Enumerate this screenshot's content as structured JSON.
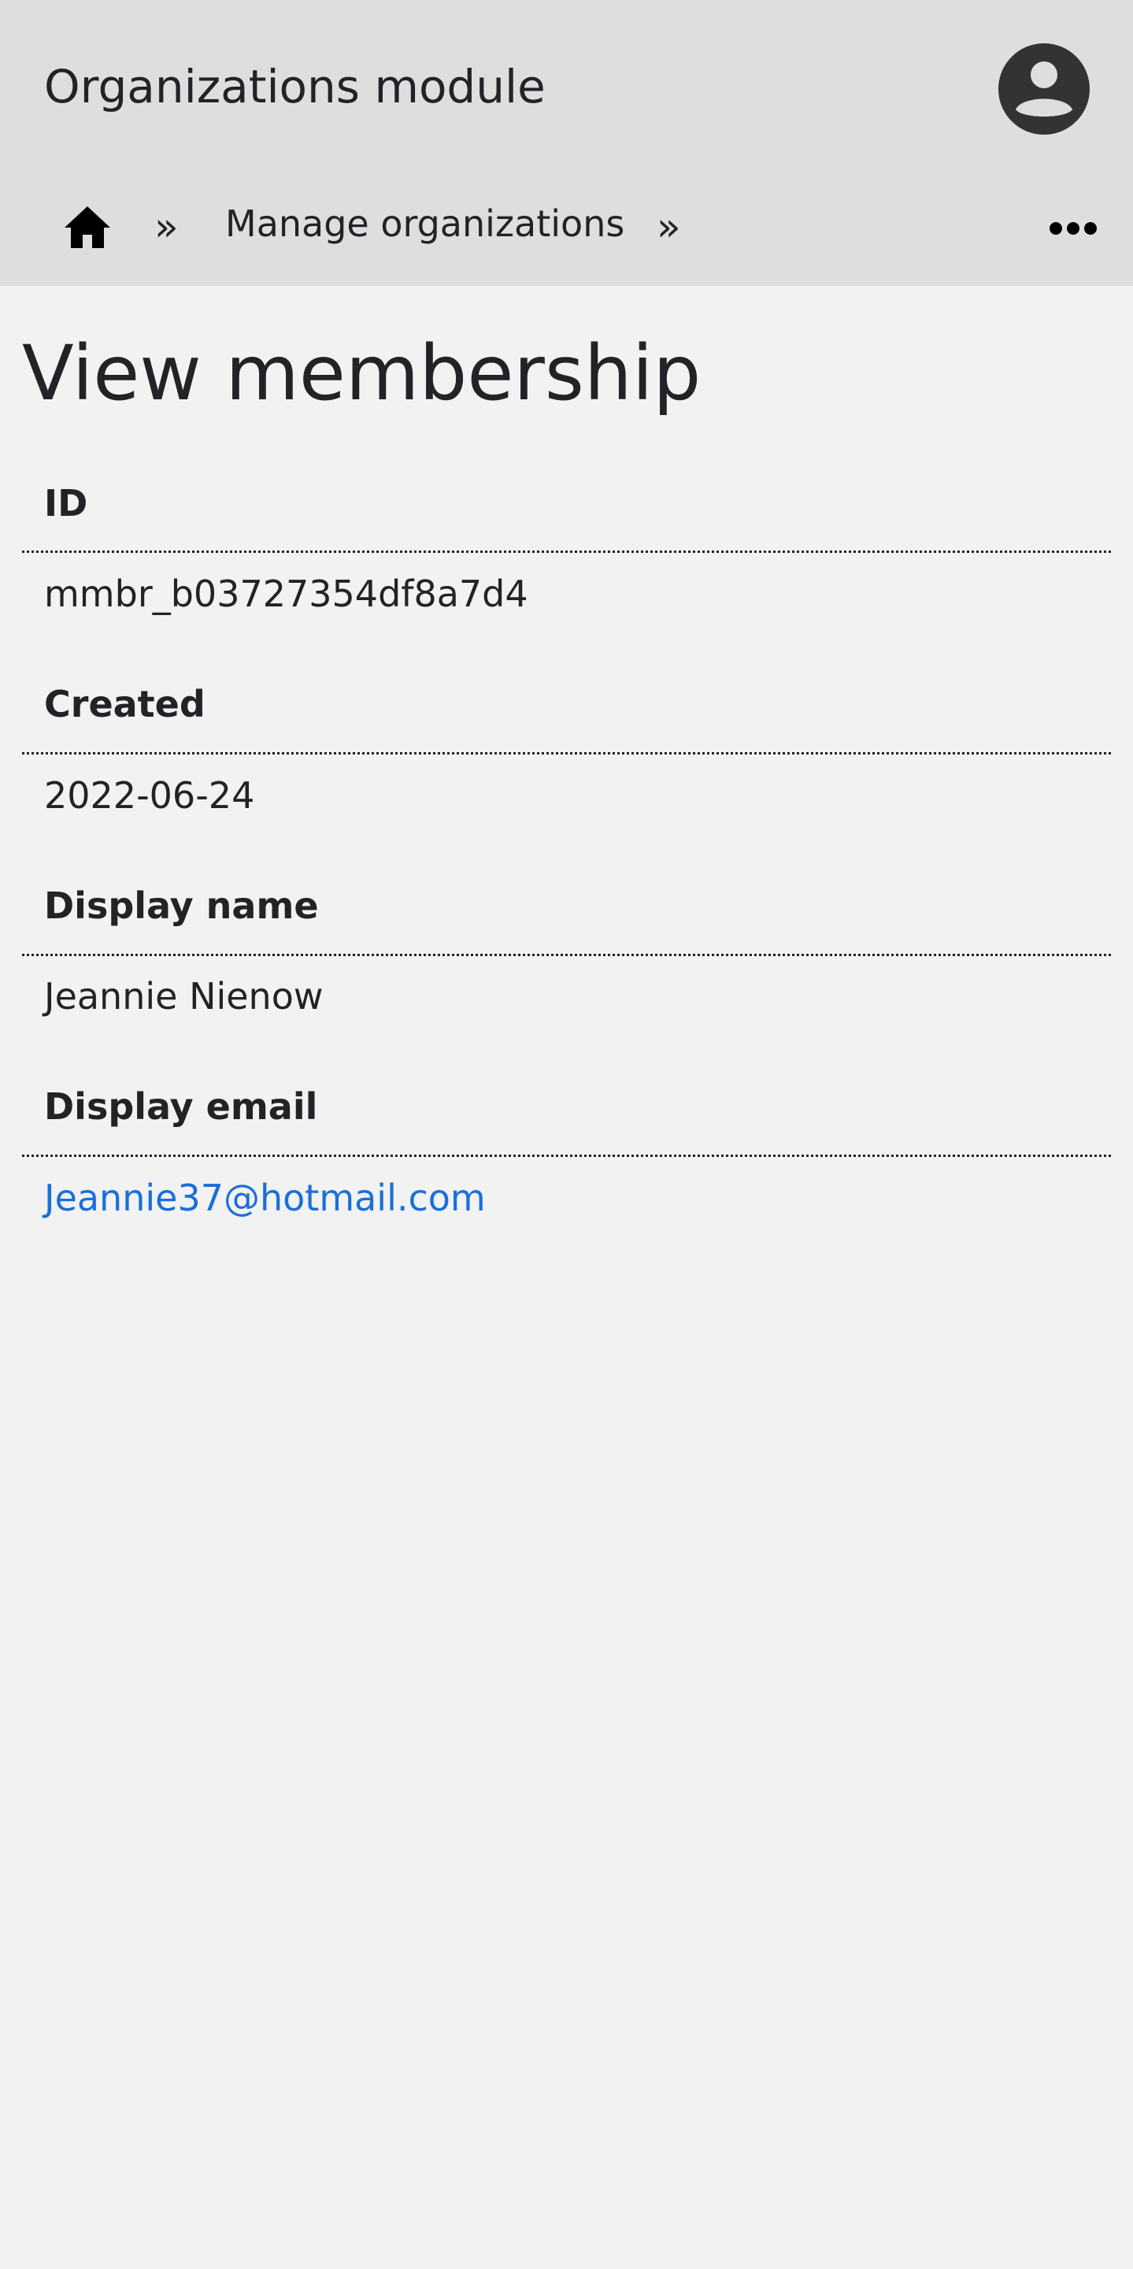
{
  "header": {
    "module_title": "Organizations module",
    "avatar_icon": "user-avatar-icon"
  },
  "breadcrumb": {
    "home_icon": "home-icon",
    "separator": "»",
    "items": [
      {
        "label": "Manage organizations"
      }
    ],
    "more_icon": "more-horizontal-icon"
  },
  "main": {
    "title": "View membership",
    "fields": [
      {
        "label": "ID",
        "value": "mmbr_b03727354df8a7d4"
      },
      {
        "label": "Created",
        "value": "2022-06-24"
      },
      {
        "label": "Display name",
        "value": "Jeannie Nienow"
      },
      {
        "label": "Display email",
        "value": "Jeannie37@hotmail.com"
      }
    ]
  },
  "colors": {
    "header_bg": "#dedede",
    "page_bg": "#f2f2f2",
    "text": "#222326",
    "link": "#1a6fd8",
    "avatar": "#333333"
  }
}
